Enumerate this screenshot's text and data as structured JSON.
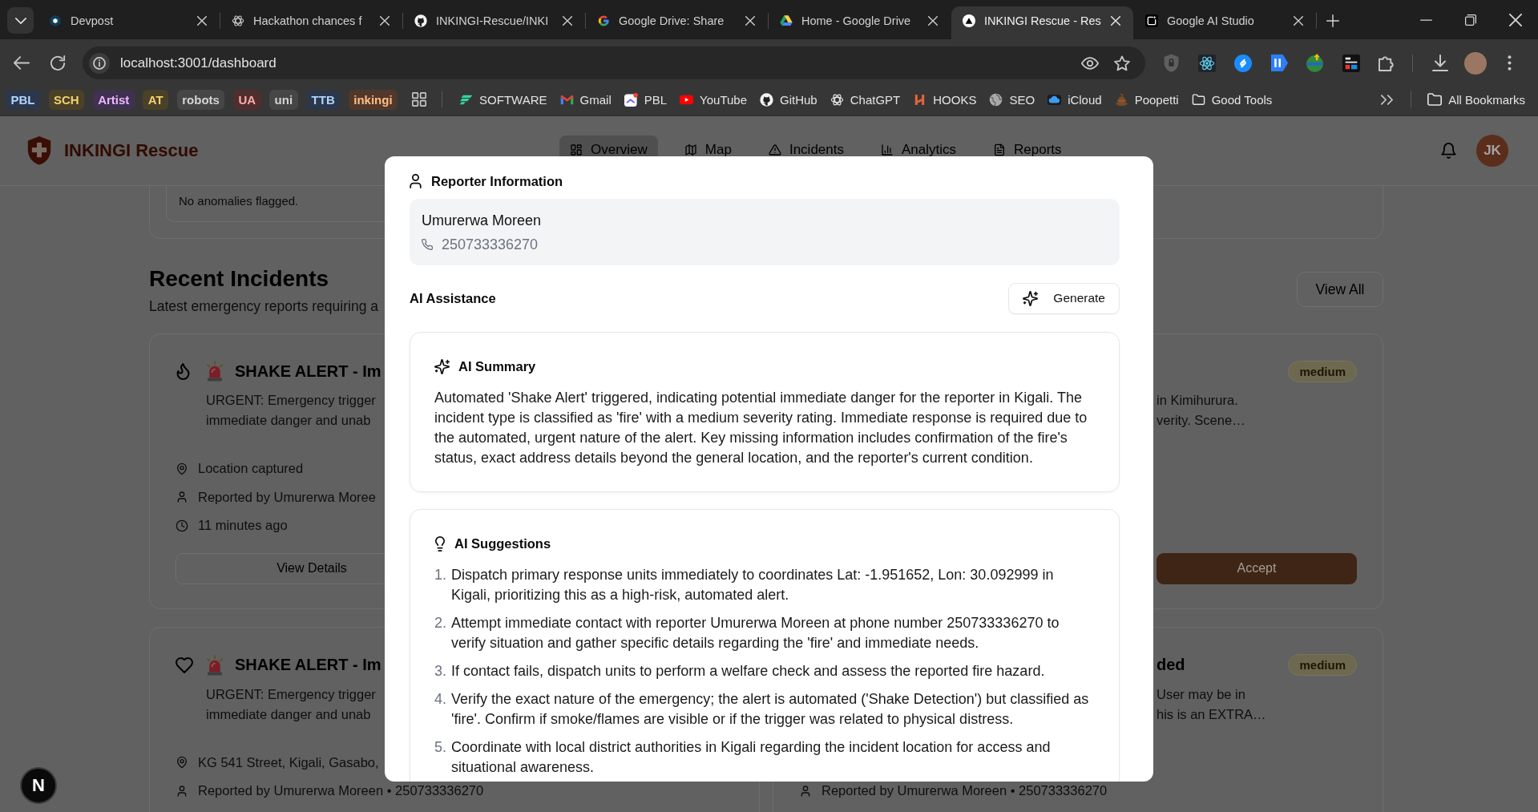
{
  "browser": {
    "tabs": [
      {
        "title": "Devpost",
        "selected": false
      },
      {
        "title": "Hackathon chances f",
        "selected": false
      },
      {
        "title": "INKINGI-Rescue/INKI",
        "selected": false
      },
      {
        "title": "Google Drive: Share",
        "selected": false
      },
      {
        "title": "Home - Google Drive",
        "selected": false
      },
      {
        "title": "INKINGI Rescue - Res",
        "selected": true
      },
      {
        "title": "Google AI Studio",
        "selected": false
      }
    ],
    "address": "localhost:3001/dashboard",
    "bookmark_groups": [
      {
        "label": "PBL",
        "color": "#2d374b"
      },
      {
        "label": "SCH",
        "color": "#4a4128"
      },
      {
        "label": "Artist",
        "color": "#3f3150"
      },
      {
        "label": "AT",
        "color": "#4a4128"
      },
      {
        "label": "robots",
        "color": "#464646"
      },
      {
        "label": "UA",
        "color": "#4f2e2e"
      },
      {
        "label": "uni",
        "color": "#464646"
      },
      {
        "label": "TTB",
        "color": "#2d374b"
      },
      {
        "label": "inkingi",
        "color": "#51382a"
      }
    ],
    "bookmarks": [
      {
        "label": "SOFTWARE"
      },
      {
        "label": "Gmail"
      },
      {
        "label": "PBL"
      },
      {
        "label": "YouTube"
      },
      {
        "label": "GitHub"
      },
      {
        "label": "ChatGPT"
      },
      {
        "label": "HOOKS"
      },
      {
        "label": "SEO"
      },
      {
        "label": "iCloud"
      },
      {
        "label": "Poopetti"
      },
      {
        "label": "Good Tools"
      }
    ],
    "all_bookmarks": "All Bookmarks"
  },
  "app": {
    "brand": "INKINGI Rescue",
    "nav": [
      {
        "label": "Overview",
        "selected": true
      },
      {
        "label": "Map",
        "selected": false
      },
      {
        "label": "Incidents",
        "selected": false
      },
      {
        "label": "Analytics",
        "selected": false
      },
      {
        "label": "Reports",
        "selected": false
      }
    ],
    "avatar": "JK",
    "anomalies_note": "No anomalies flagged.",
    "section": {
      "title": "Recent Incidents",
      "subtitle": "Latest emergency reports requiring a",
      "action": "View All"
    },
    "incident_cards": [
      {
        "kind": "fire",
        "title": "SHAKE ALERT - Im",
        "description_lines": [
          "URGENT: Emergency trigger",
          "immediate danger and unab"
        ],
        "meta": [
          {
            "kind": "location",
            "text": "Location captured"
          },
          {
            "kind": "reporter",
            "text": "Reported by Umurerwa Moree"
          },
          {
            "kind": "time",
            "text": "11 minutes ago"
          }
        ],
        "buttons": [
          {
            "kind": "secondary",
            "label": "View Details"
          }
        ]
      },
      {
        "severity": "medium",
        "description_lines": [
          "in Kimihurura.",
          "verity. Scene…"
        ],
        "buttons": [
          {
            "kind": "primary",
            "label": "Accept"
          }
        ]
      },
      {
        "kind": "medical",
        "title": "SHAKE ALERT - Im",
        "description_lines": [
          "URGENT: Emergency trigger",
          "immediate danger and unab"
        ],
        "meta": [
          {
            "kind": "location",
            "text": "KG 541 Street, Kigali, Gasabo,"
          },
          {
            "kind": "reporter",
            "text": "Reported by Umurerwa Moreen • 250733336270"
          }
        ]
      },
      {
        "title": "ded",
        "severity": "medium",
        "description_lines": [
          "User may be in",
          "his is an EXTRA…"
        ],
        "meta": [
          {
            "kind": "reporter",
            "text": "Reported by Umurerwa Moreen • 250733336270"
          }
        ]
      }
    ]
  },
  "modal": {
    "reporter": {
      "heading": "Reporter Information",
      "name": "Umurerwa Moreen",
      "phone": "250733336270"
    },
    "ai": {
      "heading": "AI Assistance",
      "action": "Generate",
      "summary": {
        "heading": "AI Summary",
        "text": "Automated 'Shake Alert' triggered, indicating potential immediate danger for the reporter in Kigali. The incident type is classified as 'fire' with a medium severity rating. Immediate response is required due to the automated, urgent nature of the alert. Key missing information includes confirmation of the fire's status, exact address details beyond the general location, and the reporter's current condition."
      },
      "suggestions": {
        "heading": "AI Suggestions",
        "items": [
          {
            "number": "1.",
            "text": "Dispatch primary response units immediately to coordinates Lat: -1.951652, Lon: 30.092999 in Kigali, prioritizing this as a high-risk, automated alert."
          },
          {
            "number": "2.",
            "text": "Attempt immediate contact with reporter Umurerwa Moreen at phone number 250733336270 to verify situation and gather specific details regarding the 'fire' and immediate needs."
          },
          {
            "number": "3.",
            "text": "If contact fails, dispatch units to perform a welfare check and assess the reported fire hazard."
          },
          {
            "number": "4.",
            "text": "Verify the exact nature of the emergency; the alert is automated ('Shake Detection') but classified as 'fire'. Confirm if smoke/flames are visible or if the trigger was related to physical distress."
          },
          {
            "number": "5.",
            "text": "Coordinate with local district authorities in Kigali regarding the incident location for access and situational awareness."
          }
        ]
      }
    }
  },
  "dev_indicator": "N"
}
